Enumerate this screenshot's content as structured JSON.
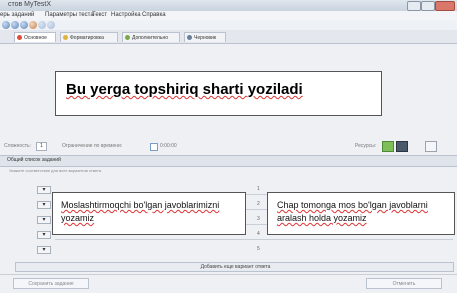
{
  "window": {
    "title": "стов MyTestX"
  },
  "menu": [
    "ерь заданий",
    "Параметры теста",
    "Текст",
    "Настройка",
    "Справка"
  ],
  "tabs": [
    {
      "label": "Основное",
      "color": "#e04b3a"
    },
    {
      "label": "Форматировка",
      "color": "#e0b43a"
    },
    {
      "label": "Дополнительно",
      "color": "#7aa84a"
    },
    {
      "label": "Черновик",
      "color": "#6a7f98"
    }
  ],
  "task": {
    "text": "Bu yerga topshiriq sharti yoziladi"
  },
  "options": {
    "complexity_label": "Сложность:",
    "complexity_value": "1",
    "time_limit_label": "Ограничение по времени:",
    "time_value": "0:00:00",
    "resources_label": "Ресурсы:"
  },
  "answers_section": {
    "header": "Общий список заданий",
    "hint": "Укажите соответствие для всех вариантов ответа",
    "left_text": "Moslashtirmoqchi bo'lgan javoblarimizni yozamiz",
    "right_text": "Chap tomonga mos bo'lgan javoblarni aralash holda yozamiz",
    "numbers": [
      "1",
      "2",
      "3",
      "4",
      "5"
    ],
    "add_button": "Добавить еще вариант ответа"
  },
  "footer": {
    "left_button": "Сохранить задание",
    "right_button": "Отменить"
  }
}
